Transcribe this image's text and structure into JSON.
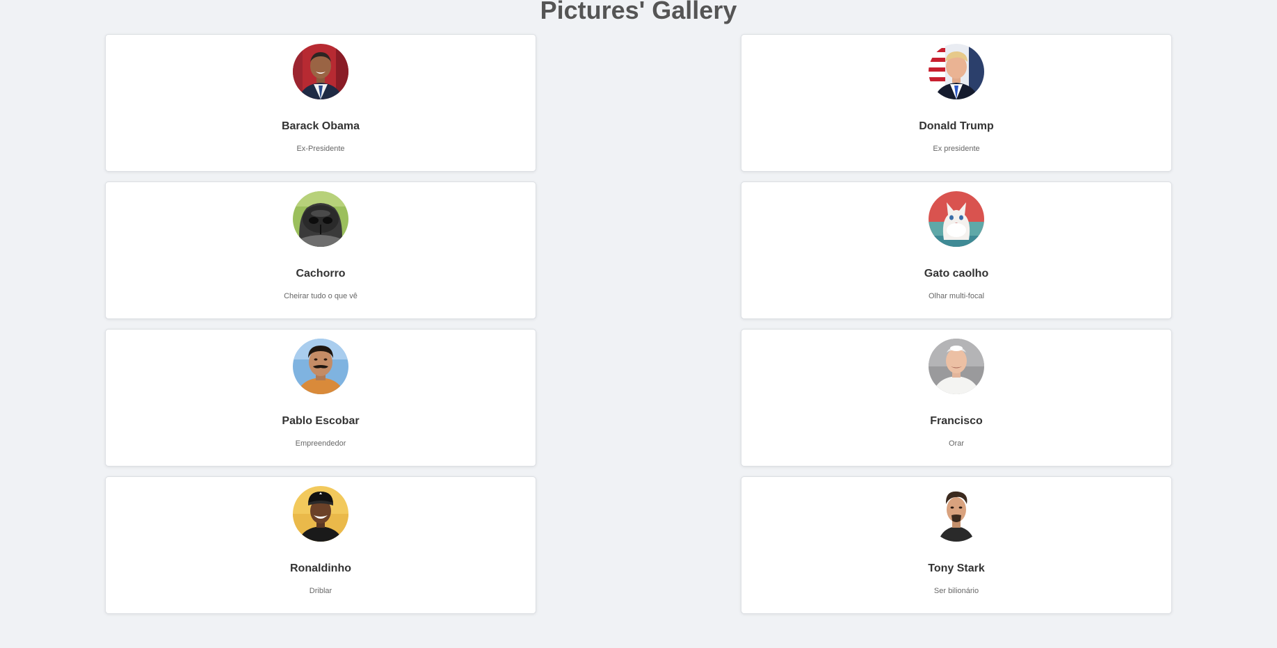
{
  "page": {
    "title": "Pictures' Gallery"
  },
  "cards": [
    {
      "name": "Barack Obama",
      "description": "Ex-Presidente",
      "avatar": "obama-portrait"
    },
    {
      "name": "Donald Trump",
      "description": "Ex presidente",
      "avatar": "trump-portrait"
    },
    {
      "name": "Cachorro",
      "description": "Cheirar tudo o que vê",
      "avatar": "dog-nose"
    },
    {
      "name": "Gato caolho",
      "description": "Olhar multi-focal",
      "avatar": "white-cat"
    },
    {
      "name": "Pablo Escobar",
      "description": "Empreendedor",
      "avatar": "escobar-portrait"
    },
    {
      "name": "Francisco",
      "description": "Orar",
      "avatar": "pope-portrait"
    },
    {
      "name": "Ronaldinho",
      "description": "Driblar",
      "avatar": "ronaldinho-portrait"
    },
    {
      "name": "Tony Stark",
      "description": "Ser bilionário",
      "avatar": "tony-stark-portrait"
    }
  ],
  "colors": {
    "background": "#f0f2f5",
    "card": "#ffffff",
    "title": "#555555",
    "name": "#333333",
    "description": "#666666"
  }
}
